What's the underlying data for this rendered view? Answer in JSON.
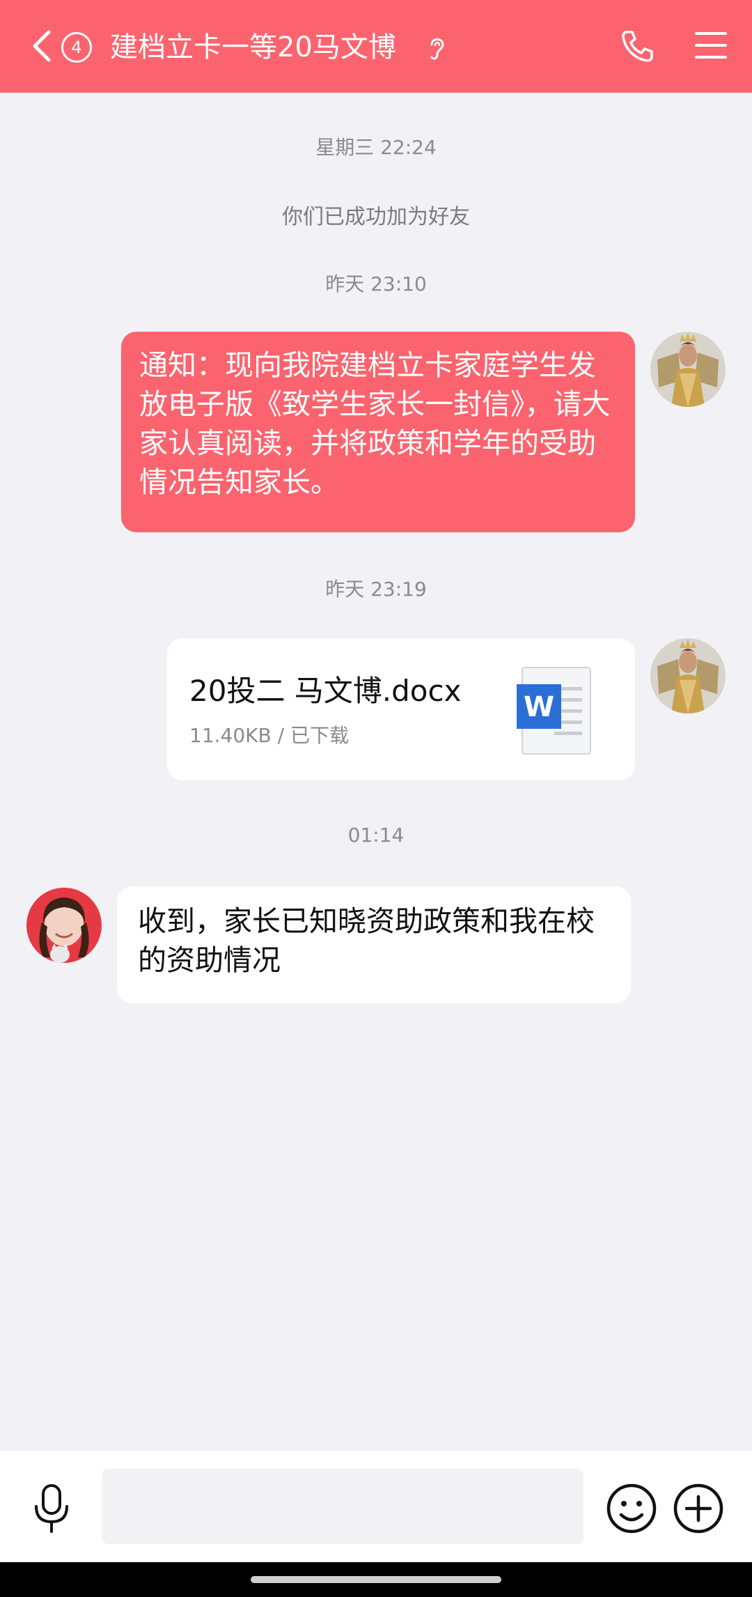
{
  "header": {
    "unread_count": "4",
    "title": "建档立卡一等20马文博",
    "accent_color": "#fb646e",
    "icons": [
      "back-icon",
      "ear-icon",
      "phone-icon",
      "menu-icon"
    ]
  },
  "messages": {
    "timestamp_1": "星期三 22:24",
    "system_notice": "你们已成功加为好友",
    "timestamp_2": "昨天 23:10",
    "notice_text": "  通知：现向我院建档立卡家庭学生发放电子版《致学生家长一封信》，请大家认真阅读，并将政策和学年的受助情况告知家长。",
    "timestamp_3": "昨天 23:19",
    "file": {
      "name": "20投二 马文博.docx",
      "meta": "11.40KB / 已下载",
      "icon": "word-doc-icon"
    },
    "timestamp_4": "01:14",
    "reply_text": "收到，家长已知晓资助政策和我在校的资助情况"
  },
  "input_bar": {
    "placeholder": "",
    "icons": [
      "mic-icon",
      "emoji-icon",
      "plus-icon"
    ]
  }
}
